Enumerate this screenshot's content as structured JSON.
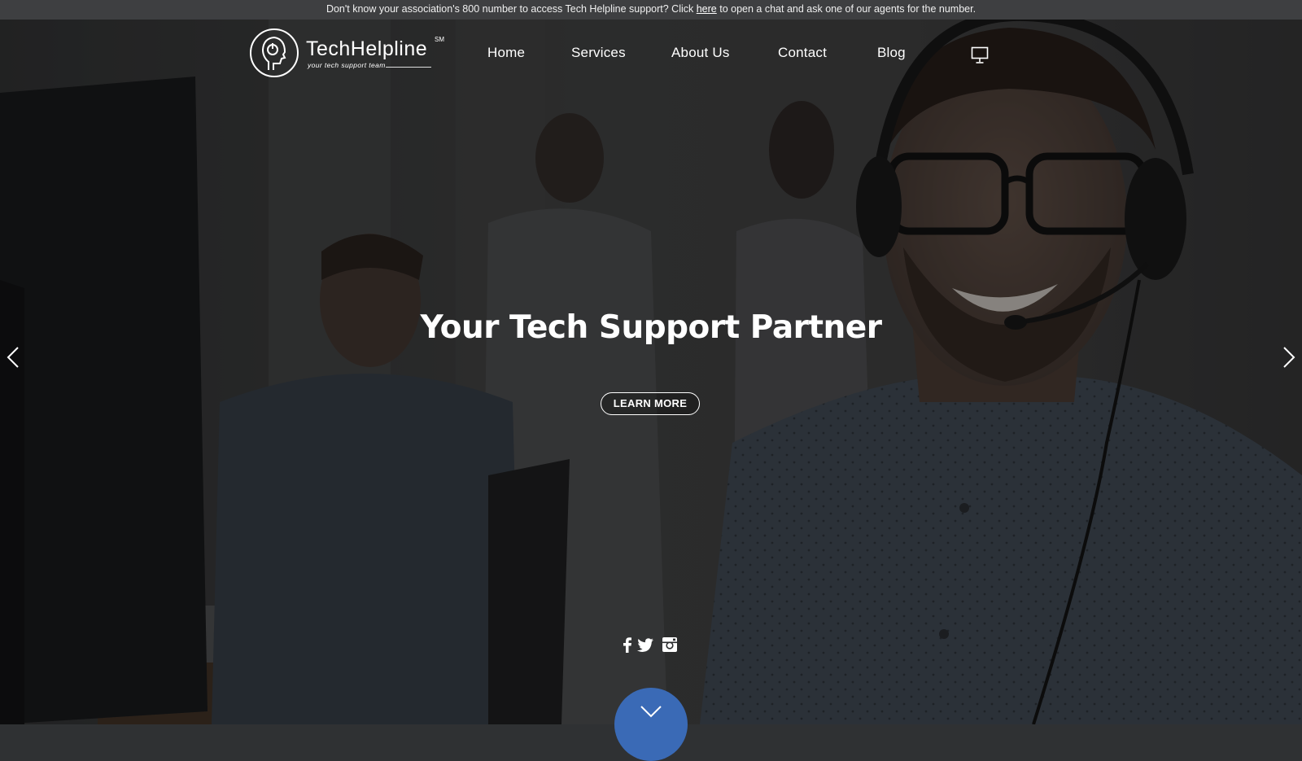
{
  "topbar": {
    "text_before": "Don't know your association's 800 number to access Tech Helpline support? Click ",
    "link_text": "here",
    "text_after": " to open a chat and ask one of our agents for the number."
  },
  "brand": {
    "name": "TechHelpline",
    "service_mark": "SM",
    "tagline": "your tech support team"
  },
  "nav": {
    "items": [
      {
        "label": "Home"
      },
      {
        "label": "Services"
      },
      {
        "label": "About Us"
      },
      {
        "label": "Contact"
      },
      {
        "label": "Blog"
      }
    ],
    "extra_icon": "monitor-icon"
  },
  "hero": {
    "headline": "Your Tech Support Partner",
    "cta_label": "LEARN MORE",
    "prev_icon": "chevron-left-icon",
    "next_icon": "chevron-right-icon"
  },
  "social": {
    "icons": [
      "facebook-icon",
      "twitter-icon",
      "instagram-icon"
    ]
  },
  "scroll_down_icon": "chevron-down-icon",
  "colors": {
    "scroll_button": "#3a6ab6",
    "topbar_bg": "#3e3f41",
    "overlay": "#2f3133"
  }
}
